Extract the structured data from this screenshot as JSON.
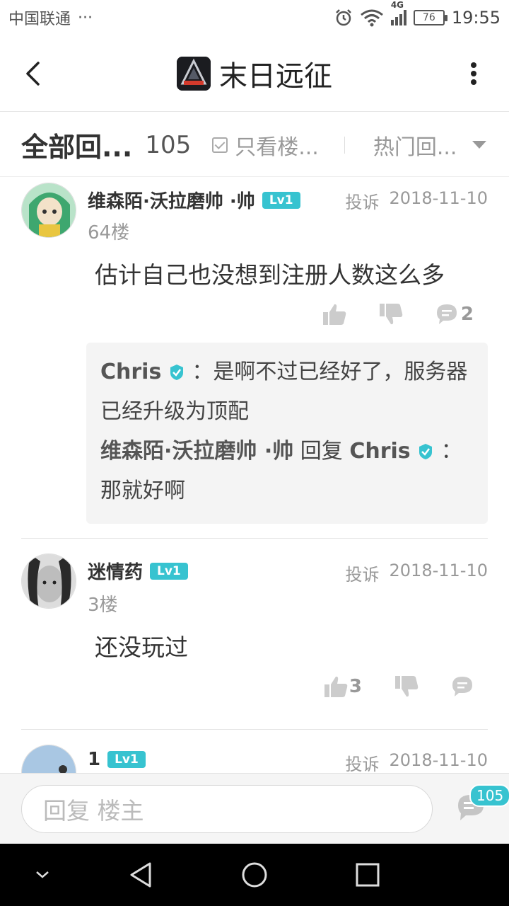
{
  "status_bar": {
    "carrier": "中国联通",
    "dots": "···",
    "network": "4G",
    "battery": "76",
    "time": "19:55"
  },
  "header": {
    "title": "末日远征",
    "logo_icon": "game-logo-icon"
  },
  "filter_bar": {
    "all_label": "全部回...",
    "count": "105",
    "only_op_label": "只看楼...",
    "sort_label": "热门回..."
  },
  "posts": [
    {
      "username": "维森陌·沃拉磨帅 ·帅",
      "level": "Lv1",
      "report": "投诉",
      "date": "2018-11-10",
      "floor": "64楼",
      "content": "估计自己也没想到注册人数这么多",
      "likes": "",
      "comments": "2",
      "replies": {
        "r1_name": "Chris",
        "r1_text": "：是啊不过已经好了，服务器已经升级为顶配",
        "r2_name": "维森陌·沃拉磨帅 ·帅",
        "r2_mid": " 回复 ",
        "r2_target": "Chris",
        "r2_text": "：那就好啊"
      }
    },
    {
      "username": "迷情药",
      "level": "Lv1",
      "report": "投诉",
      "date": "2018-11-10",
      "floor": "3楼",
      "content": "还没玩过",
      "likes": "3",
      "comments": ""
    },
    {
      "username": "1",
      "level": "Lv1",
      "report": "投诉",
      "date": "2018-11-10"
    }
  ],
  "input_bar": {
    "placeholder": "回复  楼主",
    "comment_count": "105"
  },
  "colors": {
    "accent": "#37c3d0",
    "text": "#333333",
    "muted": "#999999"
  }
}
